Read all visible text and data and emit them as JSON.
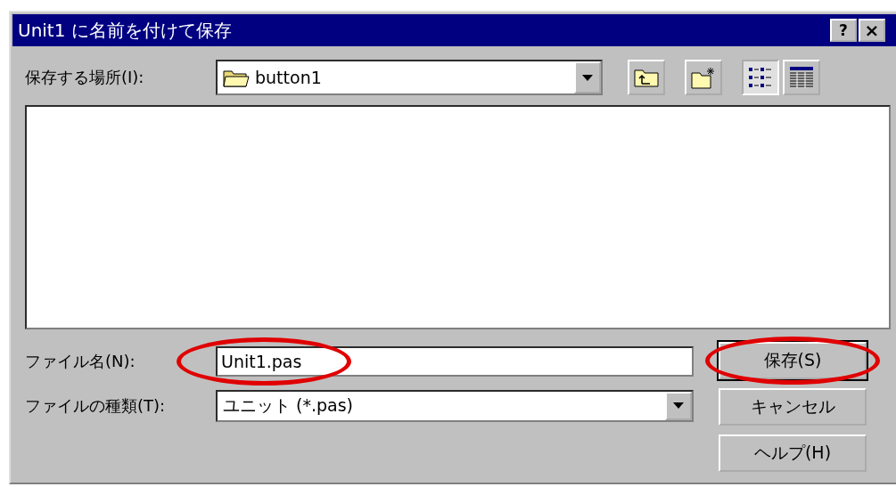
{
  "window": {
    "title": "Unit1 に名前を付けて保存",
    "title_buttons": [
      {
        "kind": "help",
        "label": "?"
      },
      {
        "kind": "close",
        "label": "×"
      }
    ]
  },
  "save_in": {
    "label": "保存する場所(I):",
    "value": "button1"
  },
  "toolbar": [
    {
      "kind": "up",
      "selected": false
    },
    {
      "kind": "new-folder",
      "selected": false
    },
    {
      "kind": "list",
      "selected": true
    },
    {
      "kind": "details",
      "selected": false
    }
  ],
  "file_name": {
    "label": "ファイル名(N):",
    "value": "Unit1.pas",
    "highlighted": true
  },
  "file_type": {
    "label": "ファイルの種類(T):",
    "value": "ユニット (*.pas)"
  },
  "buttons": [
    {
      "label": "保存(S)",
      "default": true,
      "highlighted": true
    },
    {
      "label": "キャンセル",
      "default": false,
      "highlighted": false
    },
    {
      "label": "ヘルプ(H)",
      "default": false,
      "highlighted": false
    }
  ]
}
